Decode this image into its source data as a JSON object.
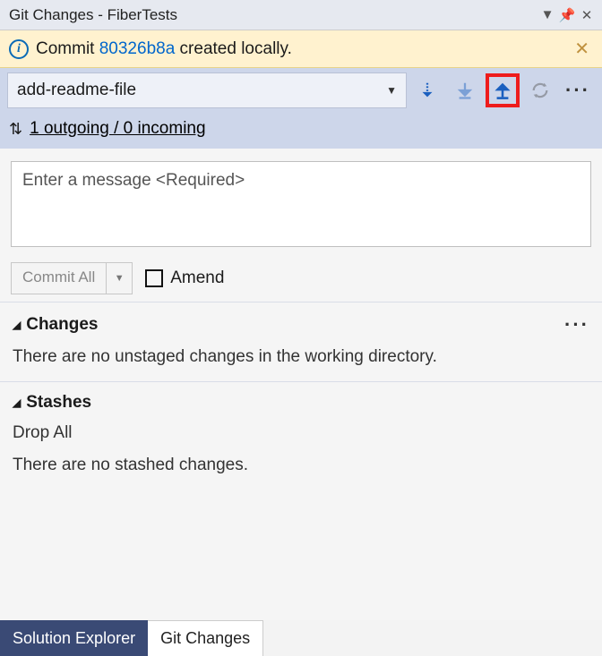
{
  "titlebar": {
    "title": "Git Changes - FiberTests"
  },
  "notification": {
    "prefix": "Commit ",
    "commit_link": "80326b8a",
    "suffix": " created locally."
  },
  "branch": {
    "selected": "add-readme-file"
  },
  "flow": {
    "text": "1 outgoing / 0 incoming"
  },
  "commit": {
    "placeholder": "Enter a message <Required>",
    "button_label": "Commit All",
    "amend_label": "Amend"
  },
  "sections": {
    "changes": {
      "title": "Changes",
      "empty": "There are no unstaged changes in the working directory."
    },
    "stashes": {
      "title": "Stashes",
      "action": "Drop All",
      "empty": "There are no stashed changes."
    }
  },
  "tabs": {
    "solution": "Solution Explorer",
    "git": "Git Changes"
  }
}
